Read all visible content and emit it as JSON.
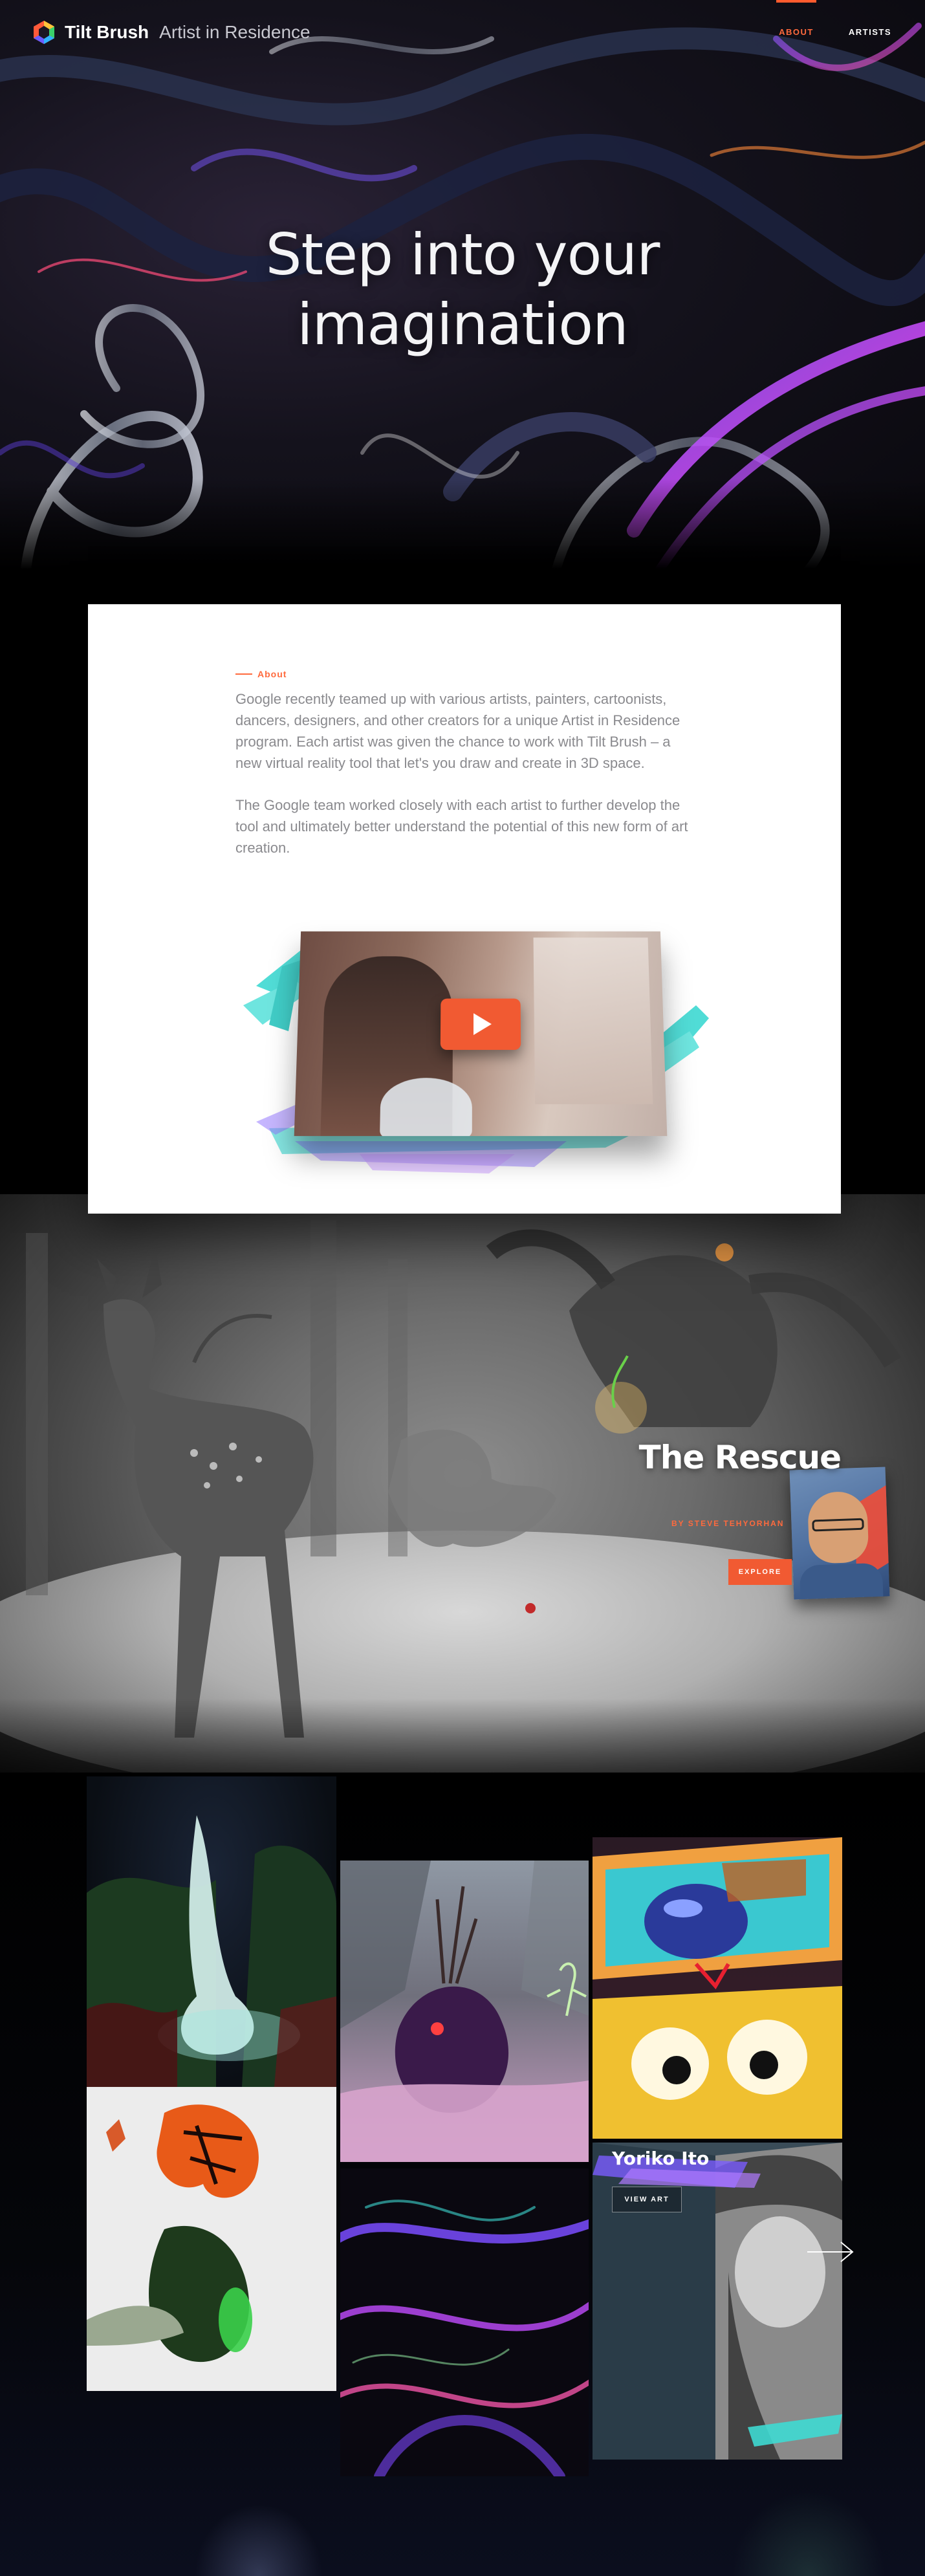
{
  "header": {
    "brand": "Tilt Brush",
    "brand_sub": "Artist in Residence",
    "nav": [
      {
        "label": "ABOUT",
        "active": true
      },
      {
        "label": "ARTISTS",
        "active": false
      }
    ]
  },
  "hero": {
    "title_line1": "Step into your",
    "title_line2": "imagination"
  },
  "about": {
    "label": "About",
    "paragraph1": "Google recently teamed up with various artists, painters, cartoonists, dancers, designers, and other creators for a unique Artist in Residence program. Each artist was given the chance to work with Tilt Brush – a new virtual reality tool that let's you draw and create in 3D space.",
    "paragraph2": "The Google team worked closely with each artist to further develop the tool and ultimately better understand the potential of this new form of art creation.",
    "video_icon": "play-icon"
  },
  "featured": {
    "title": "The Rescue",
    "byline": "BY STEVE TEHYORHAN",
    "button": "EXPLORE"
  },
  "gallery": {
    "artist_name": "Yoriko Ito",
    "button": "VIEW ART",
    "next_icon": "arrow-right-icon"
  },
  "colors": {
    "accent": "#f15a32",
    "accent_text": "#ff6a3d",
    "teal": "#3ed9d2"
  }
}
